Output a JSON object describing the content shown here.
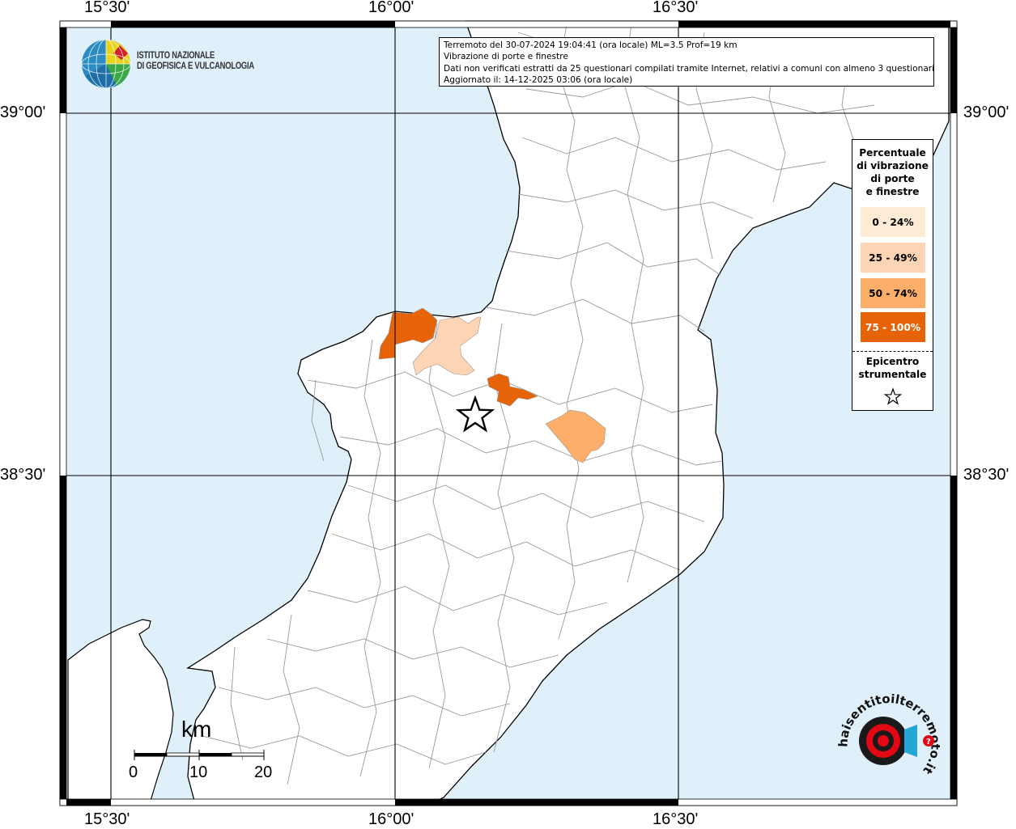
{
  "info": {
    "line1": "Terremoto del 30-07-2024 19:04:41 (ora locale) ML=3.5 Prof=19 km",
    "line2": "Vibrazione di porte e finestre",
    "line3": "Dati non verificati estratti da 25 questionari compilati tramite Internet, relativi a comuni con almeno 3 questionari.",
    "line4": "Aggiornato il: 14-12-2025 03:06 (ora locale)"
  },
  "logo": {
    "line1": "ISTITUTO NAZIONALE",
    "line2": "DI GEOFISICA E VULCANOLOGIA"
  },
  "axes": {
    "lon_labels": [
      "15°30'",
      "16°00'",
      "16°30'"
    ],
    "lat_labels": [
      "39°00'",
      "38°30'"
    ]
  },
  "legend": {
    "title": [
      "Percentuale",
      "di vibrazione",
      "di porte",
      "e finestre"
    ],
    "classes": [
      {
        "label": "0 - 24%",
        "color": "#fdebd5"
      },
      {
        "label": "25 - 49%",
        "color": "#fdd5b4"
      },
      {
        "label": "50 - 74%",
        "color": "#fdae6b"
      },
      {
        "label": "75 - 100%",
        "color": "#e66407"
      }
    ],
    "epicenter_label": [
      "Epicentro",
      "strumentale"
    ]
  },
  "scale": {
    "unit": "km",
    "ticks": [
      "0",
      "10",
      "20"
    ]
  },
  "watermark": {
    "text": "haisentitoilterremoto.it"
  },
  "colors": {
    "sea": "#dff0fb",
    "land": "#ffffff",
    "borders": "#9a9a9a",
    "grid": "#000000"
  }
}
